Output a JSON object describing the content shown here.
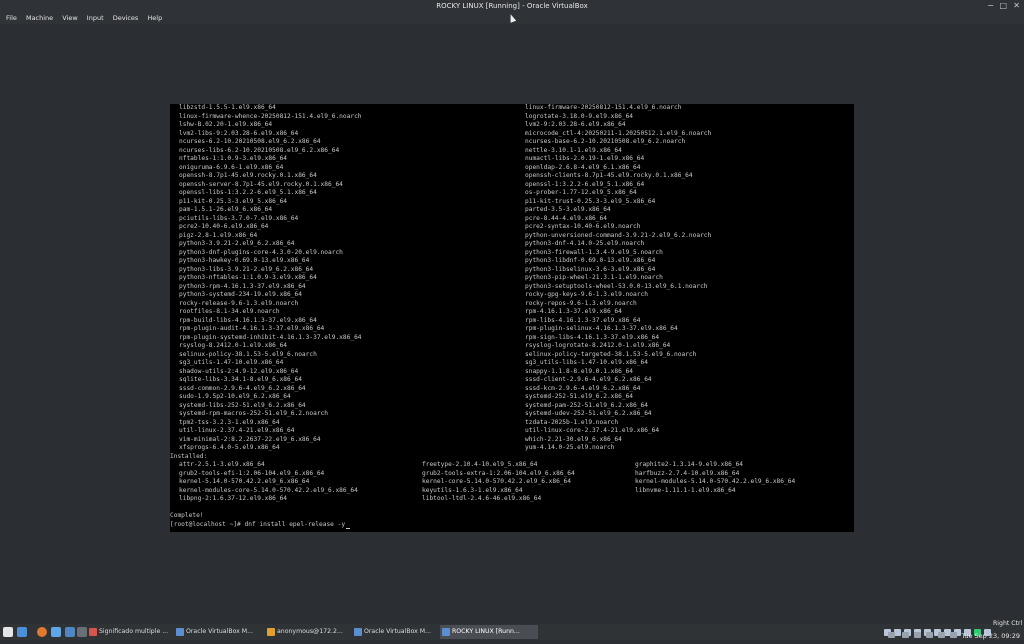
{
  "window": {
    "title": "ROCKY LINUX [Running] - Oracle VirtualBox",
    "controls": {
      "minimize": "−",
      "maximize": "□",
      "close": "✕"
    }
  },
  "menu": [
    "File",
    "Machine",
    "View",
    "Input",
    "Devices",
    "Help"
  ],
  "console": {
    "left_column": [
      "libzstd-1.5.5-1.el9.x86_64",
      "linux-firmware-whence-20250812-151.4.el9_6.noarch",
      "lshw-B.02.20-1.el9.x86_64",
      "lvm2-libs-9:2.03.28-6.el9.x86_64",
      "ncurses-6.2-10.20210508.el9_6.2.x86_64",
      "ncurses-libs-6.2-10.20210508.el9_6.2.x86_64",
      "nftables-1:1.0.9-3.el9.x86_64",
      "oniguruma-6.9.6-1.el9.x86_64",
      "openssh-8.7p1-45.el9.rocky.0.1.x86_64",
      "openssh-server-8.7p1-45.el9.rocky.0.1.x86_64",
      "openssl-libs-1:3.2.2-6.el9_5.1.x86_64",
      "p11-kit-0.25.3-3.el9_5.x86_64",
      "pam-1.5.1-26.el9_6.x86_64",
      "pciutils-libs-3.7.0-7.el9.x86_64",
      "pcre2-10.40-6.el9.x86_64",
      "pigz-2.8-1.el9.x86_64",
      "python3-3.9.21-2.el9_6.2.x86_64",
      "python3-dnf-plugins-core-4.3.0-20.el9.noarch",
      "python3-hawkey-0.69.0-13.el9.x86_64",
      "python3-libs-3.9.21-2.el9_6.2.x86_64",
      "python3-nftables-1:1.0.9-3.el9.x86_64",
      "python3-rpm-4.16.1.3-37.el9.x86_64",
      "python3-systemd-234-19.el9.x86_64",
      "rocky-release-9.6-1.3.el9.noarch",
      "rootfiles-8.1-34.el9.noarch",
      "rpm-build-libs-4.16.1.3-37.el9.x86_64",
      "rpm-plugin-audit-4.16.1.3-37.el9.x86_64",
      "rpm-plugin-systemd-inhibit-4.16.1.3-37.el9.x86_64",
      "rsyslog-8.2412.0-1.el9.x86_64",
      "selinux-policy-38.1.53-5.el9_6.noarch",
      "sg3_utils-1.47-10.el9.x86_64",
      "shadow-utils-2:4.9-12.el9.x86_64",
      "sqlite-libs-3.34.1-8.el9_6.x86_64",
      "sssd-common-2.9.6-4.el9_6.2.x86_64",
      "sudo-1.9.5p2-10.el9_6.2.x86_64",
      "systemd-libs-252-51.el9_6.2.x86_64",
      "systemd-rpm-macros-252-51.el9_6.2.noarch",
      "tpm2-tss-3.2.3-1.el9.x86_64",
      "util-linux-2.37.4-21.el9.x86_64",
      "vim-minimal-2:8.2.2637-22.el9_6.x86_64",
      "xfsprogs-6.4.0-5.el9.x86_64"
    ],
    "right_column": [
      "linux-firmware-20250812-151.4.el9_6.noarch",
      "logrotate-3.18.0-9.el9.x86_64",
      "lvm2-9:2.03.28-6.el9.x86_64",
      "microcode_ctl-4:20250211-1.20250512.1.el9_6.noarch",
      "ncurses-base-6.2-10.20210508.el9_6.2.noarch",
      "nettle-3.10.1-1.el9.x86_64",
      "numactl-libs-2.0.19-1.el9.x86_64",
      "openldap-2.6.8-4.el9_6.1.x86_64",
      "openssh-clients-8.7p1-45.el9.rocky.0.1.x86_64",
      "openssl-1:3.2.2-6.el9_5.1.x86_64",
      "os-prober-1.77-12.el9_5.x86_64",
      "p11-kit-trust-0.25.3-3.el9_5.x86_64",
      "parted-3.5-3.el9.x86_64",
      "pcre-8.44-4.el9.x86_64",
      "pcre2-syntax-10.40-6.el9.noarch",
      "python-unversioned-command-3.9.21-2.el9_6.2.noarch",
      "python3-dnf-4.14.0-25.el9.noarch",
      "python3-firewall-1.3.4-9.el9_5.noarch",
      "python3-libdnf-0.69.0-13.el9.x86_64",
      "python3-libselinux-3.6-3.el9.x86_64",
      "python3-pip-wheel-21.3.1-1.el9.noarch",
      "python3-setuptools-wheel-53.0.0-13.el9_6.1.noarch",
      "rocky-gpg-keys-9.6-1.3.el9.noarch",
      "rocky-repos-9.6-1.3.el9.noarch",
      "rpm-4.16.1.3-37.el9.x86_64",
      "rpm-libs-4.16.1.3-37.el9.x86_64",
      "rpm-plugin-selinux-4.16.1.3-37.el9.x86_64",
      "rpm-sign-libs-4.16.1.3-37.el9.x86_64",
      "rsyslog-logrotate-8.2412.0-1.el9.x86_64",
      "selinux-policy-targeted-38.1.53-5.el9_6.noarch",
      "sg3_utils-libs-1.47-10.el9.x86_64",
      "snappy-1.1.8-8.el9.0.1.x86_64",
      "sssd-client-2.9.6-4.el9_6.2.x86_64",
      "sssd-kcm-2.9.6-4.el9_6.2.x86_64",
      "systemd-252-51.el9_6.2.x86_64",
      "systemd-pam-252-51.el9_6.2.x86_64",
      "systemd-udev-252-51.el9_6.2.x86_64",
      "tzdata-2025b-1.el9.noarch",
      "util-linux-core-2.37.4-21.el9.x86_64",
      "which-2.21-30.el9_6.x86_64",
      "yum-4.14.0-25.el9.noarch"
    ],
    "installed_header": "Installed:",
    "installed": [
      [
        "attr-2.5.1-3.el9.x86_64",
        "freetype-2.10.4-10.el9_5.x86_64",
        "graphite2-1.3.14-9.el9.x86_64"
      ],
      [
        "grub2-tools-efi-1:2.06-104.el9_6.x86_64",
        "grub2-tools-extra-1:2.06-104.el9_6.x86_64",
        "harfbuzz-2.7.4-10.el9.x86_64"
      ],
      [
        "kernel-5.14.0-570.42.2.el9_6.x86_64",
        "kernel-core-5.14.0-570.42.2.el9_6.x86_64",
        "kernel-modules-5.14.0-570.42.2.el9_6.x86_64"
      ],
      [
        "kernel-modules-core-5.14.0-570.42.2.el9_6.x86_64",
        "keyutils-1.6.3-1.el9.x86_64",
        "libnvme-1.11.1-1.el9.x86_64"
      ],
      [
        "libpng-2:1.6.37-12.el9.x86_64",
        "libtool-ltdl-2.4.6-46.el9.x86_64",
        ""
      ]
    ],
    "complete": "Complete!",
    "prompt": "[root@localhost ~]# dnf install epel-release -y"
  },
  "taskbar": {
    "tasks": [
      {
        "label": "Significado multiple ...",
        "color": "#d9534f"
      },
      {
        "label": "Oracle VirtualBox M...",
        "color": "#5b8fd1"
      },
      {
        "label": "anonymous@172.2...",
        "color": "#e0a030"
      },
      {
        "label": "Oracle VirtualBox M...",
        "color": "#5b8fd1"
      },
      {
        "label": "ROCKY LINUX [Runn...",
        "color": "#5b8fd1",
        "active": true
      }
    ],
    "clock": "Tue Sep 23, 09:29",
    "status_bar_extra": "Right Ctrl"
  }
}
